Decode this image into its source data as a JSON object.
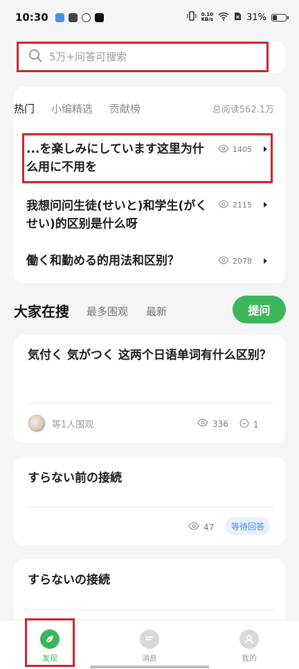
{
  "status_bar": {
    "time": "10:30",
    "net_speed_value": "0.10",
    "net_speed_unit": "KB/s",
    "battery_text": "31%",
    "battery_level": 0.31
  },
  "search": {
    "placeholder": "5万+问答可搜索"
  },
  "hot_section": {
    "tabs": [
      "热门",
      "小编精选",
      "贡献榜"
    ],
    "active_tab": "热门",
    "total_reads": "总阅读562.1万",
    "questions": [
      {
        "title": "...を楽しみにしています这里为什么用に不用を",
        "views": "1405"
      },
      {
        "title": "我想问问生徒(せいと)和学生(がくせい)的区别是什么呀",
        "views": "2115"
      },
      {
        "title": "働く和勤める的用法和区别？",
        "views": "2078"
      }
    ]
  },
  "search_section": {
    "title": "大家在搜",
    "tabs": [
      "最多围观",
      "最新"
    ],
    "ask_button": "提问"
  },
  "cards": [
    {
      "title": "気付く 気がつく 这两个日语单词有什么区别？",
      "watchers": "等1人围观",
      "views": "336",
      "answers": "1"
    },
    {
      "title": "すらない前の接続",
      "views": "47",
      "status": "等待回答"
    },
    {
      "title": "すらないの接続"
    }
  ],
  "bottom_nav": {
    "items": [
      {
        "label": "发现",
        "active": true
      },
      {
        "label": "消息",
        "active": false
      },
      {
        "label": "我的",
        "active": false
      }
    ]
  },
  "colors": {
    "accent_green": "#3cb65b",
    "highlight_red": "#d4212a",
    "badge_blue": "#3a8ee6"
  }
}
